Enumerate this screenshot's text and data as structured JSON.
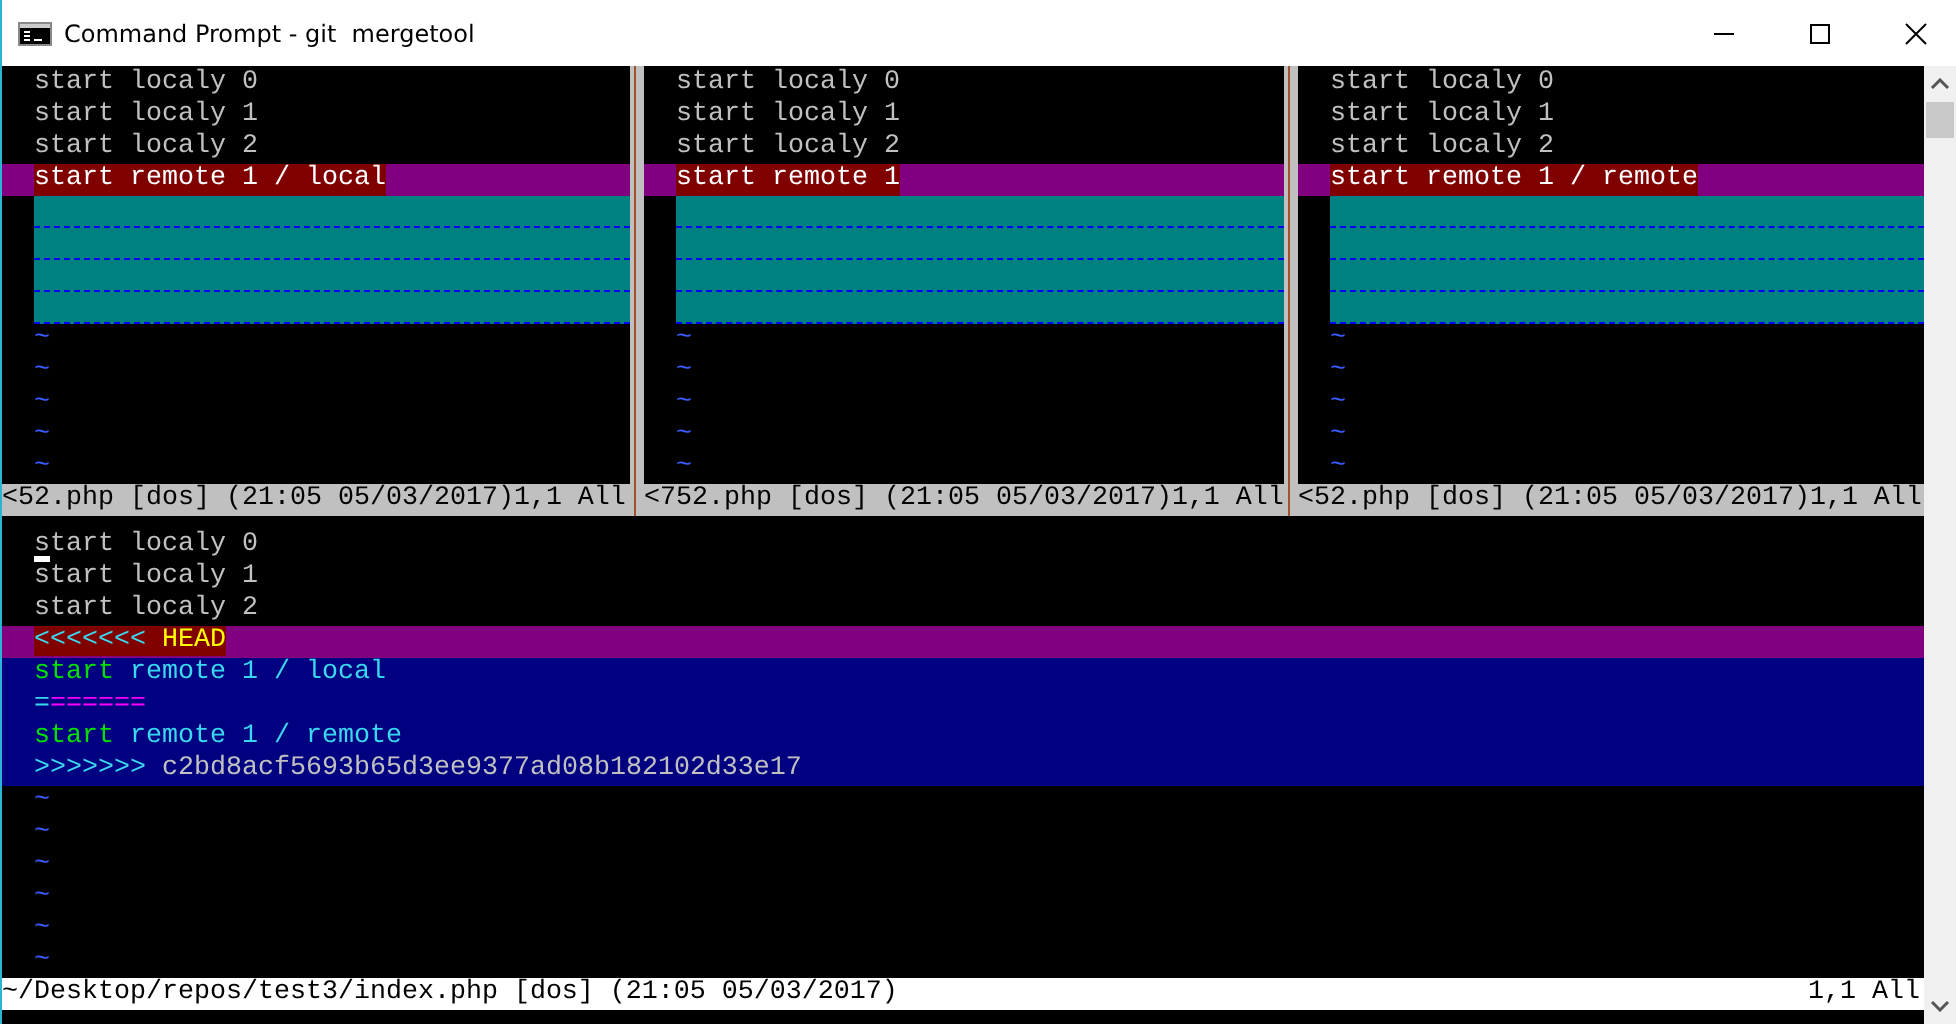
{
  "window": {
    "title": "Command Prompt - git  mergetool"
  },
  "panes": [
    {
      "lines": [
        {
          "kind": "text",
          "text": "start localy 0"
        },
        {
          "kind": "text",
          "text": "start localy 1"
        },
        {
          "kind": "text",
          "text": "start localy 2"
        },
        {
          "kind": "changed",
          "text": "start remote 1 / local"
        },
        {
          "kind": "filler"
        },
        {
          "kind": "filler"
        },
        {
          "kind": "filler"
        },
        {
          "kind": "filler"
        },
        {
          "kind": "tilde",
          "text": "~"
        },
        {
          "kind": "tilde",
          "text": "~"
        },
        {
          "kind": "tilde",
          "text": "~"
        },
        {
          "kind": "tilde",
          "text": "~"
        },
        {
          "kind": "tilde",
          "text": "~"
        }
      ],
      "status": "<52.php [dos] (21:05 05/03/2017)1,1 All"
    },
    {
      "lines": [
        {
          "kind": "text",
          "text": "start localy 0"
        },
        {
          "kind": "text",
          "text": "start localy 1"
        },
        {
          "kind": "text",
          "text": "start localy 2"
        },
        {
          "kind": "changed",
          "text": "start remote 1"
        },
        {
          "kind": "filler"
        },
        {
          "kind": "filler"
        },
        {
          "kind": "filler"
        },
        {
          "kind": "filler"
        },
        {
          "kind": "tilde",
          "text": "~"
        },
        {
          "kind": "tilde",
          "text": "~"
        },
        {
          "kind": "tilde",
          "text": "~"
        },
        {
          "kind": "tilde",
          "text": "~"
        },
        {
          "kind": "tilde",
          "text": "~"
        }
      ],
      "status": "<752.php [dos] (21:05 05/03/2017)1,1 All"
    },
    {
      "lines": [
        {
          "kind": "text",
          "text": "start localy 0"
        },
        {
          "kind": "text",
          "text": "start localy 1"
        },
        {
          "kind": "text",
          "text": "start localy 2"
        },
        {
          "kind": "changed",
          "text": "start remote 1 / remote"
        },
        {
          "kind": "filler"
        },
        {
          "kind": "filler"
        },
        {
          "kind": "filler"
        },
        {
          "kind": "filler"
        },
        {
          "kind": "tilde",
          "text": "~"
        },
        {
          "kind": "tilde",
          "text": "~"
        },
        {
          "kind": "tilde",
          "text": "~"
        },
        {
          "kind": "tilde",
          "text": "~"
        },
        {
          "kind": "tilde",
          "text": "~"
        }
      ],
      "status": "<52.php [dos] (21:05 05/03/2017)1,1 All"
    }
  ],
  "merged": {
    "lines": [
      {
        "kind": "text",
        "cursor": true,
        "segments": [
          {
            "kind": "plain",
            "text": "start localy 0"
          }
        ]
      },
      {
        "kind": "text",
        "cursor": false,
        "segments": [
          {
            "kind": "plain",
            "text": "start localy 1"
          }
        ]
      },
      {
        "kind": "text",
        "cursor": false,
        "segments": [
          {
            "kind": "plain",
            "text": "start localy 2"
          }
        ]
      },
      {
        "kind": "conflict-head",
        "cursor": false,
        "segments": [
          {
            "kind": "marker",
            "text": "<<<<<<<"
          },
          {
            "kind": "label",
            "text": " HEAD"
          }
        ]
      },
      {
        "kind": "conflict",
        "cursor": false,
        "segments": [
          {
            "kind": "keyword",
            "text": "start"
          },
          {
            "kind": "ident",
            "text": " remote 1 / local"
          }
        ]
      },
      {
        "kind": "conflict",
        "cursor": false,
        "segments": [
          {
            "kind": "marker",
            "text": "="
          },
          {
            "kind": "separator",
            "text": "======"
          }
        ]
      },
      {
        "kind": "conflict",
        "cursor": false,
        "segments": [
          {
            "kind": "keyword",
            "text": "start"
          },
          {
            "kind": "ident",
            "text": " remote 1 / remote"
          }
        ]
      },
      {
        "kind": "conflict",
        "cursor": false,
        "segments": [
          {
            "kind": "marker",
            "text": ">>>>>>>"
          },
          {
            "kind": "hash",
            "text": " c2bd8acf5693b65d3ee9377ad08b182102d33e17"
          }
        ]
      },
      {
        "kind": "tilde",
        "cursor": false,
        "segments": [
          {
            "kind": "tilde",
            "text": "~"
          }
        ]
      },
      {
        "kind": "tilde",
        "cursor": false,
        "segments": [
          {
            "kind": "tilde",
            "text": "~"
          }
        ]
      },
      {
        "kind": "tilde",
        "cursor": false,
        "segments": [
          {
            "kind": "tilde",
            "text": "~"
          }
        ]
      },
      {
        "kind": "tilde",
        "cursor": false,
        "segments": [
          {
            "kind": "tilde",
            "text": "~"
          }
        ]
      },
      {
        "kind": "tilde",
        "cursor": false,
        "segments": [
          {
            "kind": "tilde",
            "text": "~"
          }
        ]
      },
      {
        "kind": "tilde",
        "cursor": false,
        "segments": [
          {
            "kind": "tilde",
            "text": "~"
          }
        ]
      }
    ],
    "status": {
      "file": "~/Desktop/repos/test3/index.php [dos] (21:05 05/03/2017)",
      "position": "1,1 All"
    }
  }
}
